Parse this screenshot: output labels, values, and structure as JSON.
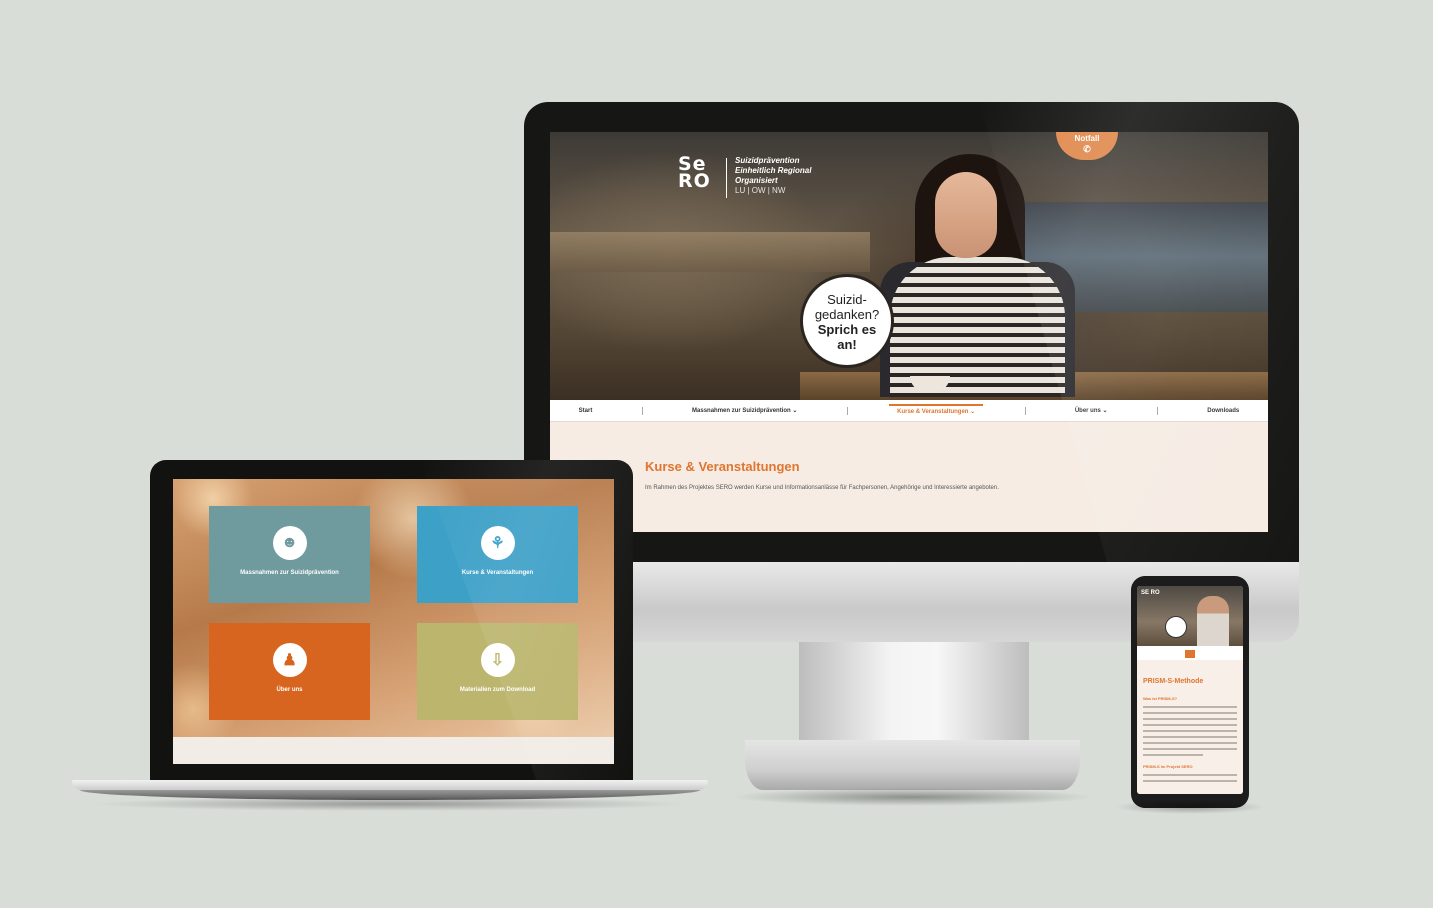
{
  "desktop": {
    "logo": {
      "mark_line1": "Se",
      "mark_line2": "RO",
      "tagline_1": "Suizidprävention",
      "tagline_2": "Einheitlich Regional",
      "tagline_3": "Organisiert",
      "cantons": "LU | OW | NW"
    },
    "notfall_label": "Notfall",
    "notfall_icon": "phone-icon",
    "bubble": {
      "line1": "Suizid-",
      "line2": "gedanken?",
      "line3": "Sprich es",
      "line4": "an!"
    },
    "nav": [
      {
        "label": "Start"
      },
      {
        "label": "Massnahmen zur Suizidprävention ⌄"
      },
      {
        "label": "Kurse & Veranstaltungen ⌄"
      },
      {
        "label": "Über uns ⌄"
      },
      {
        "label": "Downloads"
      }
    ],
    "active_nav": "Kurse & Veranstaltungen",
    "content_title": "Kurse & Veranstaltungen",
    "content_text": "Im Rahmen des Projektes SERO werden Kurse und Informationsanlässe für Fachpersonen, Angehörige und Interessierte angeboten."
  },
  "laptop": {
    "tiles": [
      {
        "label": "Massnahmen zur Suizidprävention",
        "icon": "person-icon",
        "color": "#6f9a9e"
      },
      {
        "label": "Kurse & Veranstaltungen",
        "icon": "group-icon",
        "color": "#3da0c7"
      },
      {
        "label": "Über uns",
        "icon": "team-icon",
        "color": "#d8651f"
      },
      {
        "label": "Materialien zum Download",
        "icon": "download-icon",
        "color": "#bcb56e"
      }
    ]
  },
  "phone": {
    "logo": "SE RO",
    "title": "PRISM-S-Methode",
    "subtitle": "Was ist PRISM-S?",
    "subtitle2": "PRISM-S im Projekt SERO"
  },
  "colors": {
    "accent": "#e0752f",
    "background": "#d9ddd8"
  }
}
